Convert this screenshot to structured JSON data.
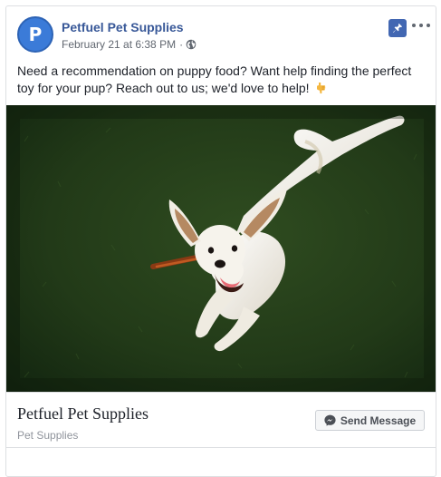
{
  "post": {
    "page_name": "Petfuel Pet Supplies",
    "avatar_letter": "P",
    "timestamp": "February 21 at 6:38 PM",
    "meta_separator": "·",
    "audience_icon": "globe-icon",
    "pinned_icon": "pin-icon",
    "options_icon": "more-options-icon",
    "text": "Need a recommendation on puppy food? Want help finding the perfect toy for your pup? Reach out to us; we'd love to help!",
    "emoji": "backhand-index-pointing-down",
    "photo_subject": "dog-photo"
  },
  "attachment": {
    "title": "Petfuel Pet Supplies",
    "subtitle": "Pet Supplies",
    "button_label": "Send Message",
    "button_icon": "messenger-icon"
  },
  "colors": {
    "link_blue": "#385898",
    "avatar_blue": "#3b7bd8",
    "pin_blue": "#4267b2",
    "muted_text": "#616770",
    "border": "#dddfe2",
    "grass_dark": "#1e3616",
    "dog_white": "#f3f1ea"
  }
}
